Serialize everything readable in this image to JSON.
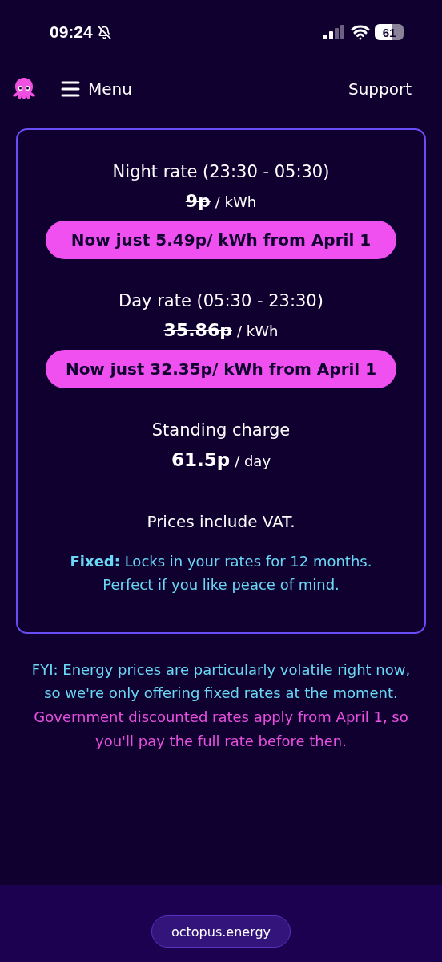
{
  "status_bar": {
    "time": "09:24",
    "battery": "61"
  },
  "header": {
    "menu_label": "Menu",
    "support_label": "Support"
  },
  "rates": [
    {
      "name": "Night rate (23:30 - 05:30)",
      "old_price": "9p",
      "unit": "/ kWh",
      "offer": "Now just 5.49p/ kWh from April 1"
    },
    {
      "name": "Day rate (05:30 - 23:30)",
      "old_price": "35.86p",
      "unit": "/ kWh",
      "offer": "Now just 32.35p/ kWh from April 1"
    }
  ],
  "standing_charge": {
    "label": "Standing charge",
    "price": "61.5p",
    "unit": "/ day"
  },
  "vat_note": "Prices include VAT.",
  "fixed_note": "**Fixed:** Locks in your rates for 12 months. Perfect if you like peace of mind.",
  "notes": [
    {
      "kind": "info",
      "text": "FYI: Energy prices are particularly volatile right now, so we're only offering fixed rates at the moment."
    },
    {
      "kind": "notice",
      "text": "Government discounted rates apply from April 1, so you'll pay the full rate before then."
    }
  ],
  "url_pill": "octopus.energy"
}
